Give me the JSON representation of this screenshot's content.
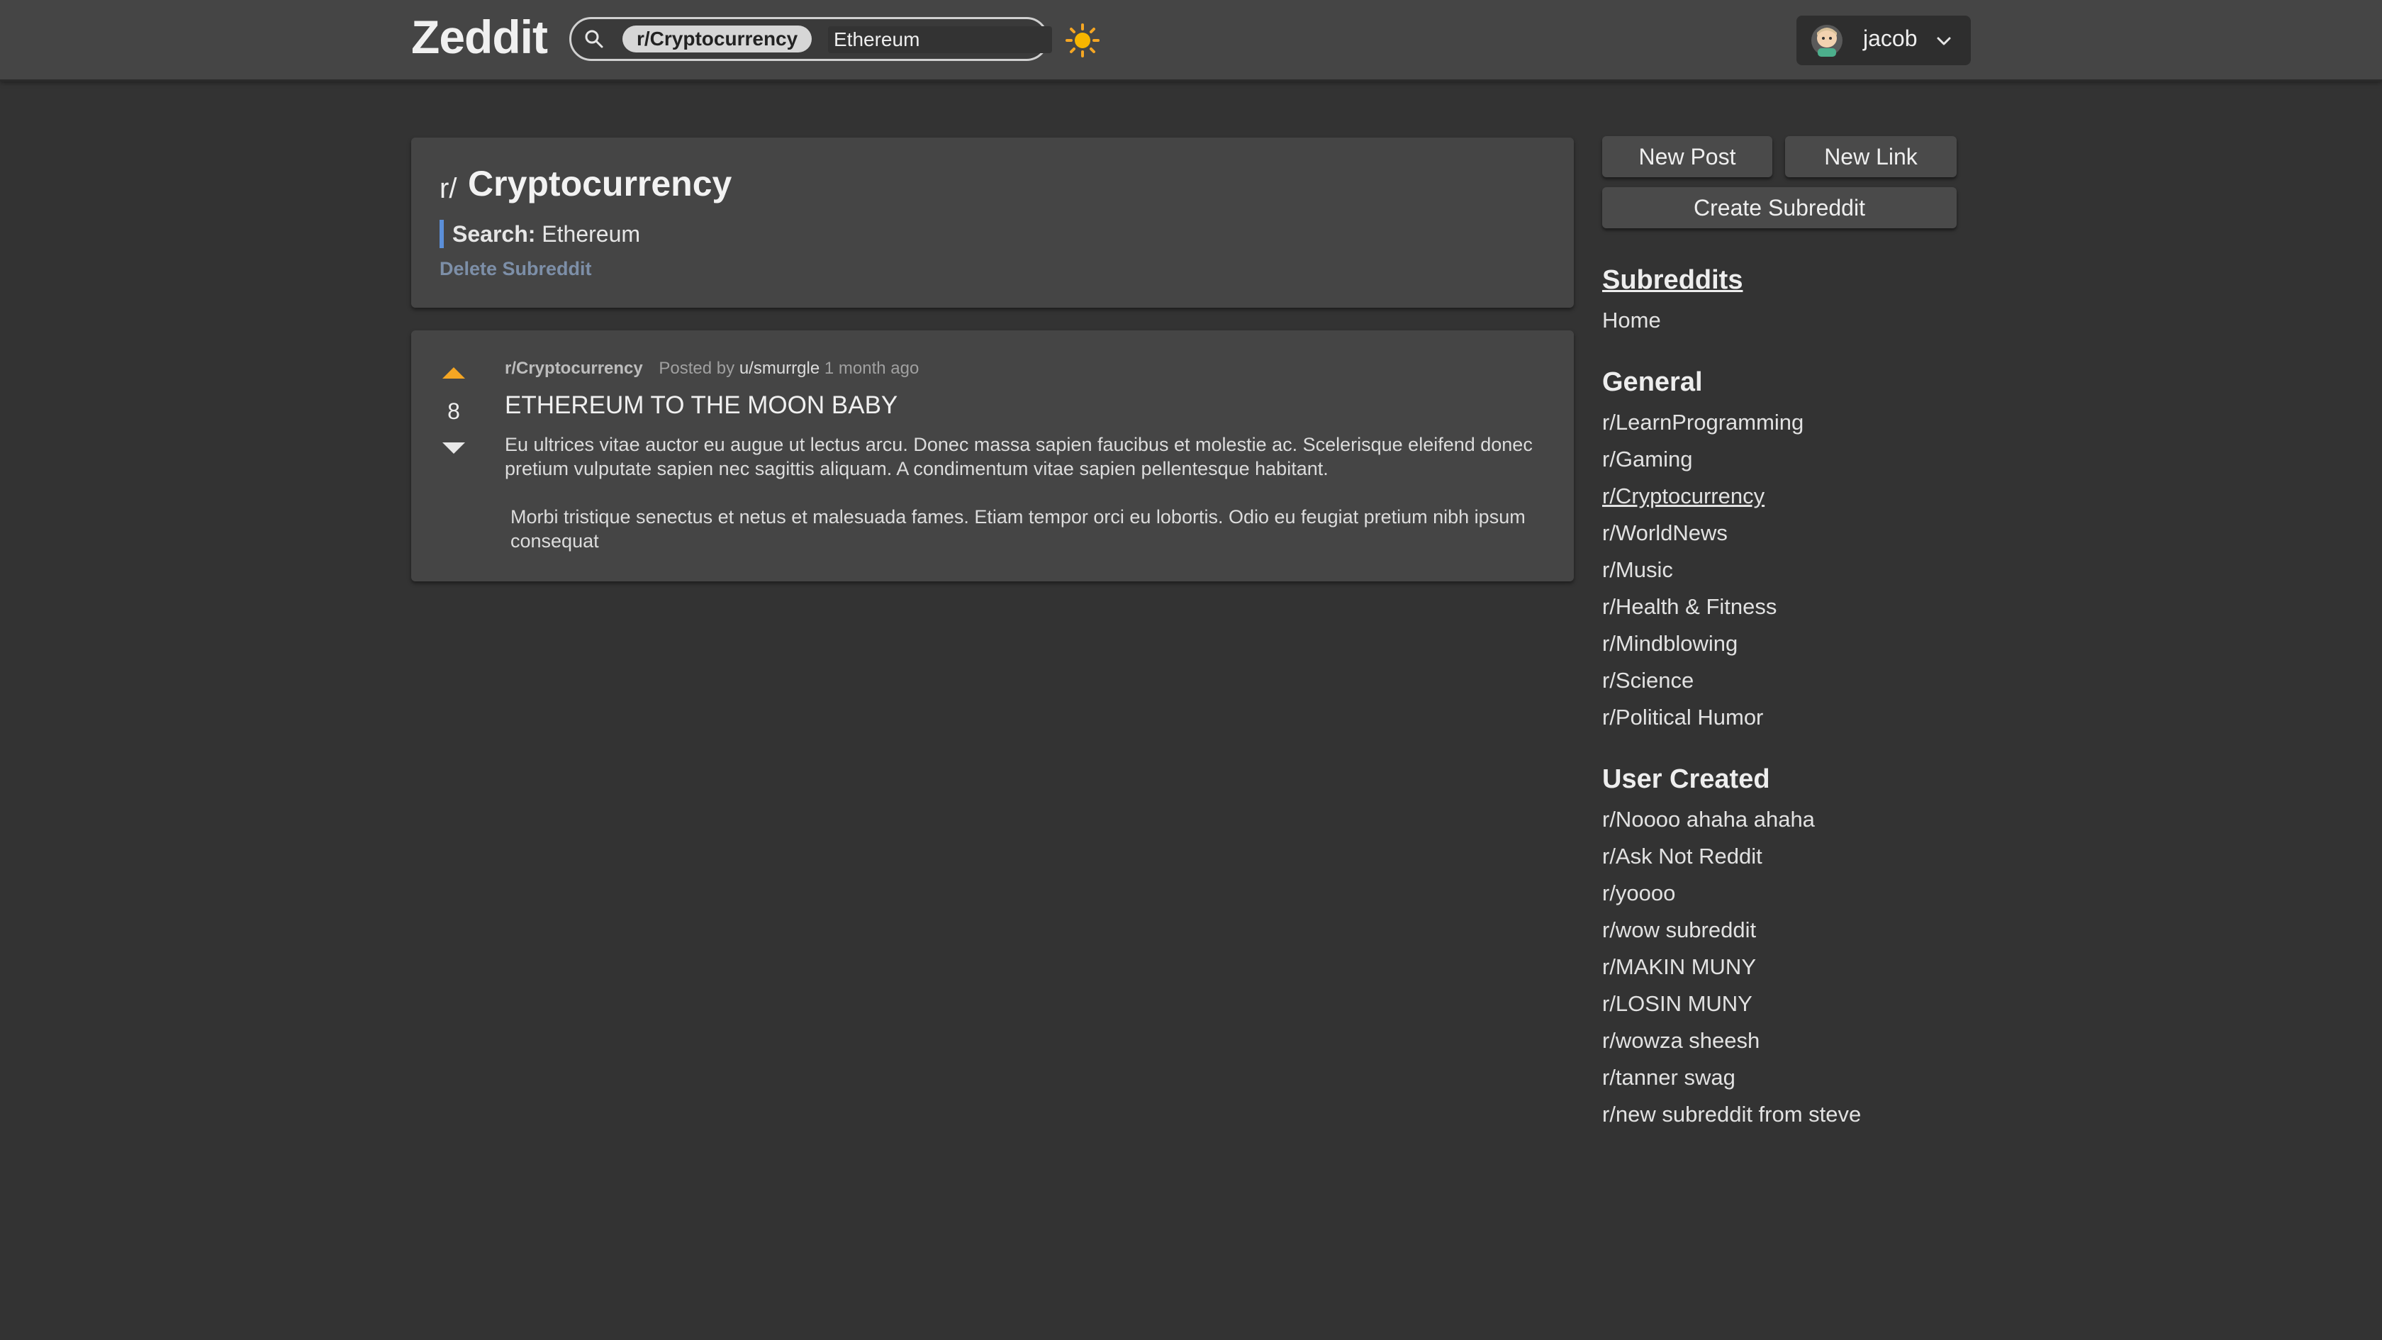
{
  "header": {
    "logo": "Zeddit",
    "search": {
      "subreddit_chip": "r/Cryptocurrency",
      "query": "Ethereum"
    },
    "theme_icon": "sun-icon",
    "user": {
      "name": "jacob",
      "avatar_icon": "avatar-icon",
      "menu_icon": "chevron-down-icon"
    }
  },
  "subreddit": {
    "prefix": "r/",
    "name": "Cryptocurrency",
    "search_label": "Search:",
    "search_term": "Ethereum",
    "delete_label": "Delete Subreddit"
  },
  "posts": [
    {
      "subreddit": "r/Cryptocurrency",
      "posted_by_label": "Posted by",
      "author": "u/smurrgle",
      "age": "1 month ago",
      "score": "8",
      "title": "ETHEREUM TO THE MOON BABY",
      "body_p1": "Eu ultrices vitae auctor eu augue ut lectus arcu. Donec massa sapien faucibus et molestie ac. Scelerisque eleifend donec pretium vulputate sapien nec sagittis aliquam. A condimentum vitae sapien pellentesque habitant.",
      "body_p2": "Morbi tristique senectus et netus et malesuada fames. Etiam tempor orci eu lobortis. Odio eu feugiat pretium nibh ipsum consequat"
    }
  ],
  "sidebar": {
    "new_post": "New Post",
    "new_link": "New Link",
    "create_subreddit": "Create Subreddit",
    "subreddits_heading": "Subreddits",
    "home": "Home",
    "general_heading": "General",
    "general": [
      "r/LearnProgramming",
      "r/Gaming",
      "r/Cryptocurrency",
      "r/WorldNews",
      "r/Music",
      "r/Health & Fitness",
      "r/Mindblowing",
      "r/Science",
      "r/Political Humor"
    ],
    "user_created_heading": "User Created",
    "user_created": [
      "r/Noooo ahaha ahaha",
      "r/Ask Not Reddit",
      "r/yoooo",
      "r/wow subreddit",
      "r/MAKIN MUNY",
      "r/LOSIN MUNY",
      "r/wowza sheesh",
      "r/tanner swag",
      "r/new subreddit from steve"
    ]
  },
  "colors": {
    "background": "#333333",
    "card": "#454545",
    "accent": "#5b8fd9",
    "upvote": "#f5a623"
  }
}
